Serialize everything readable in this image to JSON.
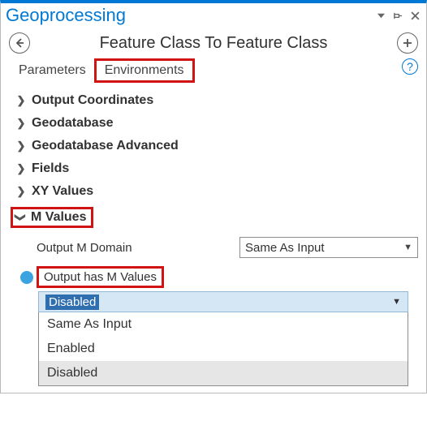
{
  "panel": {
    "title": "Geoprocessing"
  },
  "header": {
    "tool_title": "Feature Class To Feature Class"
  },
  "tabs": {
    "parameters": "Parameters",
    "environments": "Environments"
  },
  "sections": {
    "output_coordinates": "Output Coordinates",
    "geodatabase": "Geodatabase",
    "geodatabase_advanced": "Geodatabase Advanced",
    "fields": "Fields",
    "xy_values": "XY Values",
    "m_values": "M Values"
  },
  "m_values": {
    "output_m_domain_label": "Output M Domain",
    "output_m_domain_value": "Same As Input",
    "output_has_m_label": "Output has M Values",
    "output_has_m_selected": "Disabled",
    "options": [
      "Same As Input",
      "Enabled",
      "Disabled"
    ]
  }
}
